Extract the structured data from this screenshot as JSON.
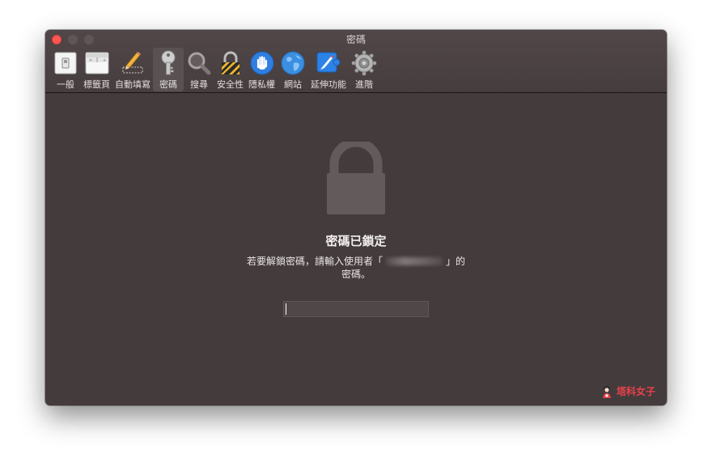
{
  "window": {
    "title": "密碼"
  },
  "toolbar": {
    "items": [
      {
        "label": "一般",
        "icon": "general-switch-icon"
      },
      {
        "label": "標籤頁",
        "icon": "tabs-window-icon"
      },
      {
        "label": "自動填寫",
        "icon": "autofill-pencil-icon"
      },
      {
        "label": "密碼",
        "icon": "key-icon",
        "active": true
      },
      {
        "label": "搜尋",
        "icon": "magnifier-icon"
      },
      {
        "label": "安全性",
        "icon": "security-lock-icon"
      },
      {
        "label": "隱私權",
        "icon": "privacy-hand-icon"
      },
      {
        "label": "網站",
        "icon": "globe-icon"
      },
      {
        "label": "延伸功能",
        "icon": "extensions-icon"
      },
      {
        "label": "進階",
        "icon": "gear-icon"
      }
    ]
  },
  "locked": {
    "title": "密碼已鎖定",
    "message_before": "若要解鎖密碼，請輸入使用者「",
    "message_after": "」的",
    "message_line2": "密碼。",
    "password_value": ""
  },
  "watermark": {
    "text": "塔科女子"
  },
  "colors": {
    "window_bg": "#443b3c",
    "toolbar_bg": "#4e4445",
    "active_tab_bg": "#5a5152",
    "close_button": "#fc5753",
    "watermark": "#e8424a"
  }
}
